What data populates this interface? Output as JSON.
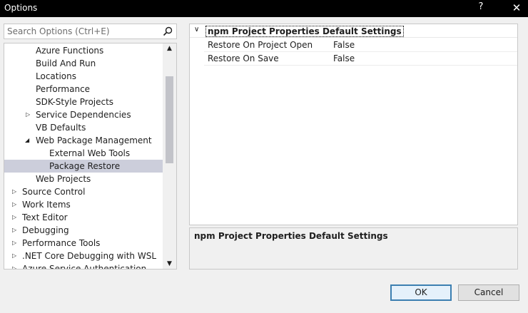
{
  "window": {
    "title": "Options",
    "help_glyph": "?",
    "close_glyph": "✕"
  },
  "search": {
    "placeholder": "Search Options (Ctrl+E)"
  },
  "tree": {
    "items": [
      {
        "label": "Azure Functions"
      },
      {
        "label": "Build And Run"
      },
      {
        "label": "Locations"
      },
      {
        "label": "Performance"
      },
      {
        "label": "SDK-Style Projects"
      },
      {
        "label": "Service Dependencies"
      },
      {
        "label": "VB Defaults"
      },
      {
        "label": "Web Package Management"
      },
      {
        "label": "External Web Tools"
      },
      {
        "label": "Package Restore"
      },
      {
        "label": "Web Projects"
      },
      {
        "label": "Source Control"
      },
      {
        "label": "Work Items"
      },
      {
        "label": "Text Editor"
      },
      {
        "label": "Debugging"
      },
      {
        "label": "Performance Tools"
      },
      {
        "label": ".NET Core Debugging with WSL"
      },
      {
        "label": "Azure Service Authentication"
      }
    ]
  },
  "properties": {
    "category": "npm Project Properties Default Settings",
    "rows": [
      {
        "name": "Restore On Project Open",
        "value": "False"
      },
      {
        "name": "Restore On Save",
        "value": "False"
      }
    ]
  },
  "description": {
    "title": "npm Project Properties Default Settings"
  },
  "buttons": {
    "ok": "OK",
    "cancel": "Cancel"
  }
}
